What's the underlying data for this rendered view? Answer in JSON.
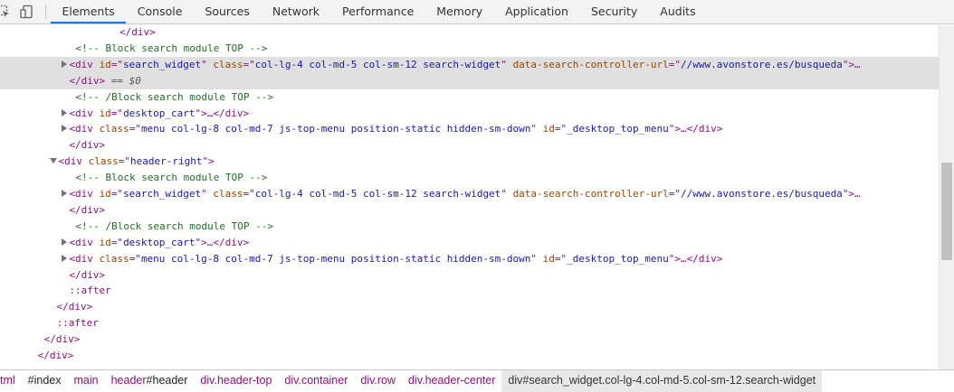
{
  "toolbar": {
    "inspect_icon": "inspect-cursor-icon",
    "device_icon": "device-toggle-icon",
    "tabs": [
      {
        "label": "Elements",
        "active": true
      },
      {
        "label": "Console"
      },
      {
        "label": "Sources"
      },
      {
        "label": "Network"
      },
      {
        "label": "Performance"
      },
      {
        "label": "Memory"
      },
      {
        "label": "Application"
      },
      {
        "label": "Security"
      },
      {
        "label": "Audits"
      }
    ]
  },
  "tree": {
    "selected_marker": "== $0",
    "lines": [
      {
        "indent": 19,
        "parts": [
          {
            "t": "</div>",
            "c": "tag"
          }
        ]
      },
      {
        "indent": 12,
        "parts": [
          {
            "t": "<!-- Block search module TOP -->",
            "c": "cm"
          }
        ]
      },
      {
        "indent": 11,
        "selected": true,
        "tri": "closed",
        "parts": [
          {
            "t": "<div ",
            "c": "tag"
          },
          {
            "t": "id",
            "c": "an"
          },
          {
            "t": "=\"",
            "c": "tag"
          },
          {
            "t": "search_widget",
            "c": "av"
          },
          {
            "t": "\" ",
            "c": "tag"
          },
          {
            "t": "class",
            "c": "an"
          },
          {
            "t": "=\"",
            "c": "tag"
          },
          {
            "t": "col-lg-4 col-md-5 col-sm-12 search-widget",
            "c": "av"
          },
          {
            "t": "\" ",
            "c": "tag"
          },
          {
            "t": "data-search-controller-url",
            "c": "an"
          },
          {
            "t": "=\"",
            "c": "tag"
          },
          {
            "t": "//www.avonstore.es/busqueda",
            "c": "av"
          },
          {
            "t": "\">…",
            "c": "tag"
          }
        ]
      },
      {
        "indent": 11,
        "selected": true,
        "parts": [
          {
            "t": "</div>",
            "c": "tag"
          },
          {
            "t": " == $0",
            "c": "eq"
          }
        ]
      },
      {
        "indent": 12,
        "parts": [
          {
            "t": "<!-- /Block search module TOP -->",
            "c": "cm"
          }
        ]
      },
      {
        "indent": 11,
        "tri": "closed",
        "parts": [
          {
            "t": "<div ",
            "c": "tag"
          },
          {
            "t": "id",
            "c": "an"
          },
          {
            "t": "=\"",
            "c": "tag"
          },
          {
            "t": "desktop_cart",
            "c": "av"
          },
          {
            "t": "\">…</div>",
            "c": "tag"
          }
        ]
      },
      {
        "indent": 11,
        "tri": "closed",
        "parts": [
          {
            "t": "<div ",
            "c": "tag"
          },
          {
            "t": "class",
            "c": "an"
          },
          {
            "t": "=\"",
            "c": "tag"
          },
          {
            "t": "menu col-lg-8 col-md-7 js-top-menu position-static hidden-sm-down",
            "c": "av"
          },
          {
            "t": "\" ",
            "c": "tag"
          },
          {
            "t": "id",
            "c": "an"
          },
          {
            "t": "=\"",
            "c": "tag"
          },
          {
            "t": "_desktop_top_menu",
            "c": "av"
          },
          {
            "t": "\">…</div>",
            "c": "tag"
          }
        ]
      },
      {
        "indent": 11,
        "parts": [
          {
            "t": "</div>",
            "c": "tag"
          }
        ]
      },
      {
        "indent": 9,
        "tri": "open",
        "parts": [
          {
            "t": "<div ",
            "c": "tag"
          },
          {
            "t": "class",
            "c": "an"
          },
          {
            "t": "=\"",
            "c": "tag"
          },
          {
            "t": "header-right",
            "c": "av"
          },
          {
            "t": "\">",
            "c": "tag"
          }
        ]
      },
      {
        "indent": 12,
        "parts": [
          {
            "t": "<!-- Block search module TOP -->",
            "c": "cm"
          }
        ]
      },
      {
        "indent": 11,
        "tri": "closed",
        "parts": [
          {
            "t": "<div ",
            "c": "tag"
          },
          {
            "t": "id",
            "c": "an"
          },
          {
            "t": "=\"",
            "c": "tag"
          },
          {
            "t": "search_widget",
            "c": "av"
          },
          {
            "t": "\" ",
            "c": "tag"
          },
          {
            "t": "class",
            "c": "an"
          },
          {
            "t": "=\"",
            "c": "tag"
          },
          {
            "t": "col-lg-4 col-md-5 col-sm-12 search-widget",
            "c": "av"
          },
          {
            "t": "\" ",
            "c": "tag"
          },
          {
            "t": "data-search-controller-url",
            "c": "an"
          },
          {
            "t": "=\"",
            "c": "tag"
          },
          {
            "t": "//www.avonstore.es/busqueda",
            "c": "av"
          },
          {
            "t": "\">…",
            "c": "tag"
          }
        ]
      },
      {
        "indent": 11,
        "parts": [
          {
            "t": "</div>",
            "c": "tag"
          }
        ]
      },
      {
        "indent": 12,
        "parts": [
          {
            "t": "<!-- /Block search module TOP -->",
            "c": "cm"
          }
        ]
      },
      {
        "indent": 11,
        "tri": "closed",
        "parts": [
          {
            "t": "<div ",
            "c": "tag"
          },
          {
            "t": "id",
            "c": "an"
          },
          {
            "t": "=\"",
            "c": "tag"
          },
          {
            "t": "desktop_cart",
            "c": "av"
          },
          {
            "t": "\">…</div>",
            "c": "tag"
          }
        ]
      },
      {
        "indent": 11,
        "tri": "closed",
        "parts": [
          {
            "t": "<div ",
            "c": "tag"
          },
          {
            "t": "class",
            "c": "an"
          },
          {
            "t": "=\"",
            "c": "tag"
          },
          {
            "t": "menu col-lg-8 col-md-7 js-top-menu position-static hidden-sm-down",
            "c": "av"
          },
          {
            "t": "\" ",
            "c": "tag"
          },
          {
            "t": "id",
            "c": "an"
          },
          {
            "t": "=\"",
            "c": "tag"
          },
          {
            "t": "_desktop_top_menu",
            "c": "av"
          },
          {
            "t": "\">…</div>",
            "c": "tag"
          }
        ]
      },
      {
        "indent": 11,
        "parts": [
          {
            "t": "</div>",
            "c": "tag"
          }
        ]
      },
      {
        "indent": 11,
        "parts": [
          {
            "t": "::after",
            "c": "ps"
          }
        ]
      },
      {
        "indent": 9,
        "parts": [
          {
            "t": "</div>",
            "c": "tag"
          }
        ]
      },
      {
        "indent": 9,
        "parts": [
          {
            "t": "::after",
            "c": "ps"
          }
        ]
      },
      {
        "indent": 7,
        "parts": [
          {
            "t": "</div>",
            "c": "tag"
          }
        ]
      },
      {
        "indent": 6,
        "parts": [
          {
            "t": "</div>",
            "c": "tag"
          }
        ]
      }
    ]
  },
  "breadcrumb": {
    "items": [
      {
        "label": "tml",
        "kind": "tag"
      },
      {
        "label": "#index",
        "kind": "plain"
      },
      {
        "label": "main",
        "kind": "tag"
      },
      {
        "label": "header#header",
        "kind": "mixed",
        "tag": "header",
        "rest": "#header"
      },
      {
        "label": "div.header-top",
        "kind": "tag"
      },
      {
        "label": "div.container",
        "kind": "tag"
      },
      {
        "label": "div.row",
        "kind": "tag"
      },
      {
        "label": "div.header-center",
        "kind": "tag"
      },
      {
        "label": "div#search_widget.col-lg-4.col-md-5.col-sm-12.search-widget",
        "kind": "selected"
      }
    ]
  },
  "colors": {
    "tag": "#881280",
    "attr_name": "#994500",
    "attr_value": "#1a1aa6",
    "comment": "#236e25",
    "selection": "#e0e0e0",
    "active_tab_underline": "#1a73e8"
  }
}
